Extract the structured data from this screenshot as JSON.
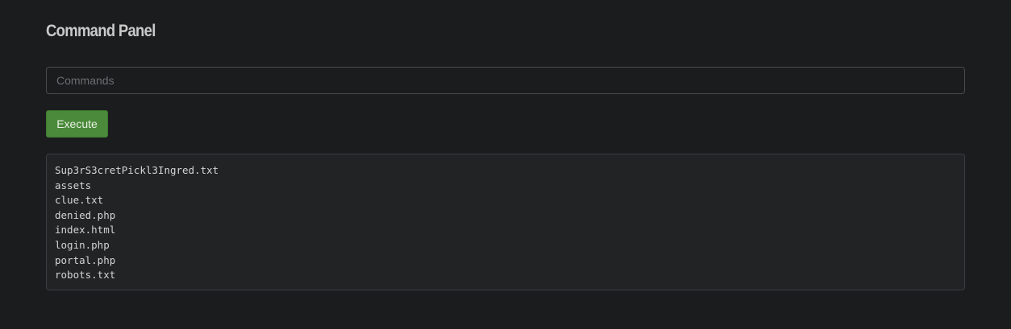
{
  "panel": {
    "title": "Command Panel"
  },
  "command_input": {
    "value": "",
    "placeholder": "Commands"
  },
  "execute_button": {
    "label": "Execute"
  },
  "output": {
    "lines": [
      "Sup3rS3cretPickl3Ingred.txt",
      "assets",
      "clue.txt",
      "denied.php",
      "index.html",
      "login.php",
      "portal.php",
      "robots.txt"
    ]
  }
}
